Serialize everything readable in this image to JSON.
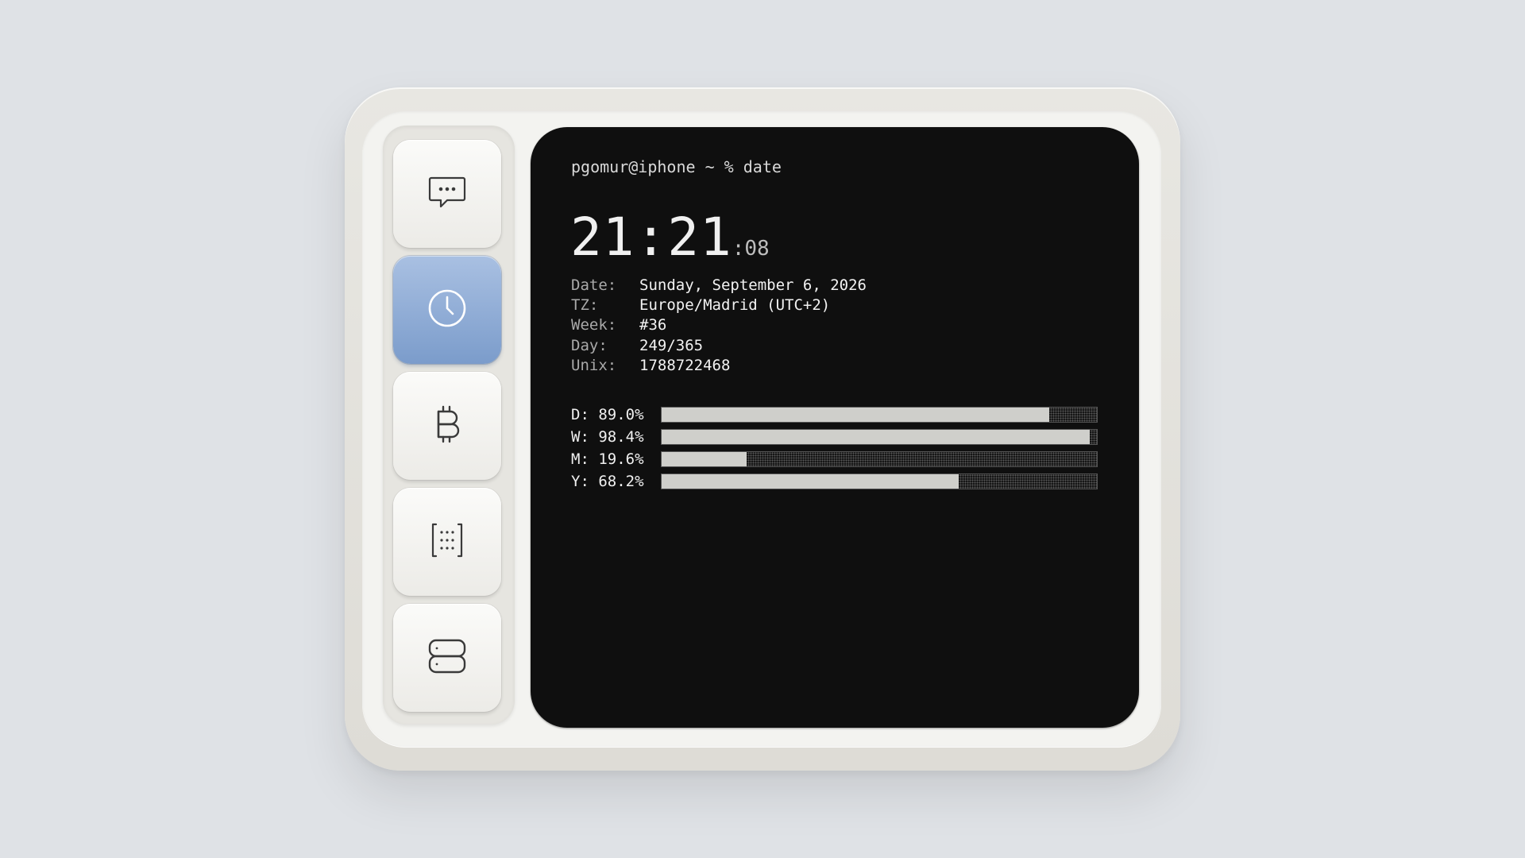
{
  "dock": {
    "items": [
      {
        "name": "messages",
        "icon": "chat-bubble-icon",
        "active": false
      },
      {
        "name": "clock",
        "icon": "clock-icon",
        "active": true
      },
      {
        "name": "bitcoin",
        "icon": "bitcoin-icon",
        "active": false
      },
      {
        "name": "grid",
        "icon": "dot-grid-brackets-icon",
        "active": false
      },
      {
        "name": "server",
        "icon": "server-icon",
        "active": false
      }
    ],
    "active_color": "#8aa8d4"
  },
  "terminal": {
    "prompt": "pgomur@iphone ~ % date",
    "time_hm": "21:21",
    "time_sec": ":08",
    "info": [
      {
        "key": "Date:",
        "value": "Sunday, September 6, 2026"
      },
      {
        "key": "TZ:",
        "value": "Europe/Madrid (UTC+2)"
      },
      {
        "key": "Week:",
        "value": "#36"
      },
      {
        "key": "Day:",
        "value": "249/365"
      },
      {
        "key": "Unix:",
        "value": "1788722468"
      }
    ],
    "progress": [
      {
        "label": "D: 89.0%",
        "value": 0.89
      },
      {
        "label": "W: 98.4%",
        "value": 0.984
      },
      {
        "label": "M: 19.6%",
        "value": 0.196
      },
      {
        "label": "Y: 68.2%",
        "value": 0.682
      }
    ]
  },
  "colors": {
    "background": "#dfe2e6",
    "screen": "#0f0f0f",
    "bar_fill": "#cfcfcb"
  }
}
